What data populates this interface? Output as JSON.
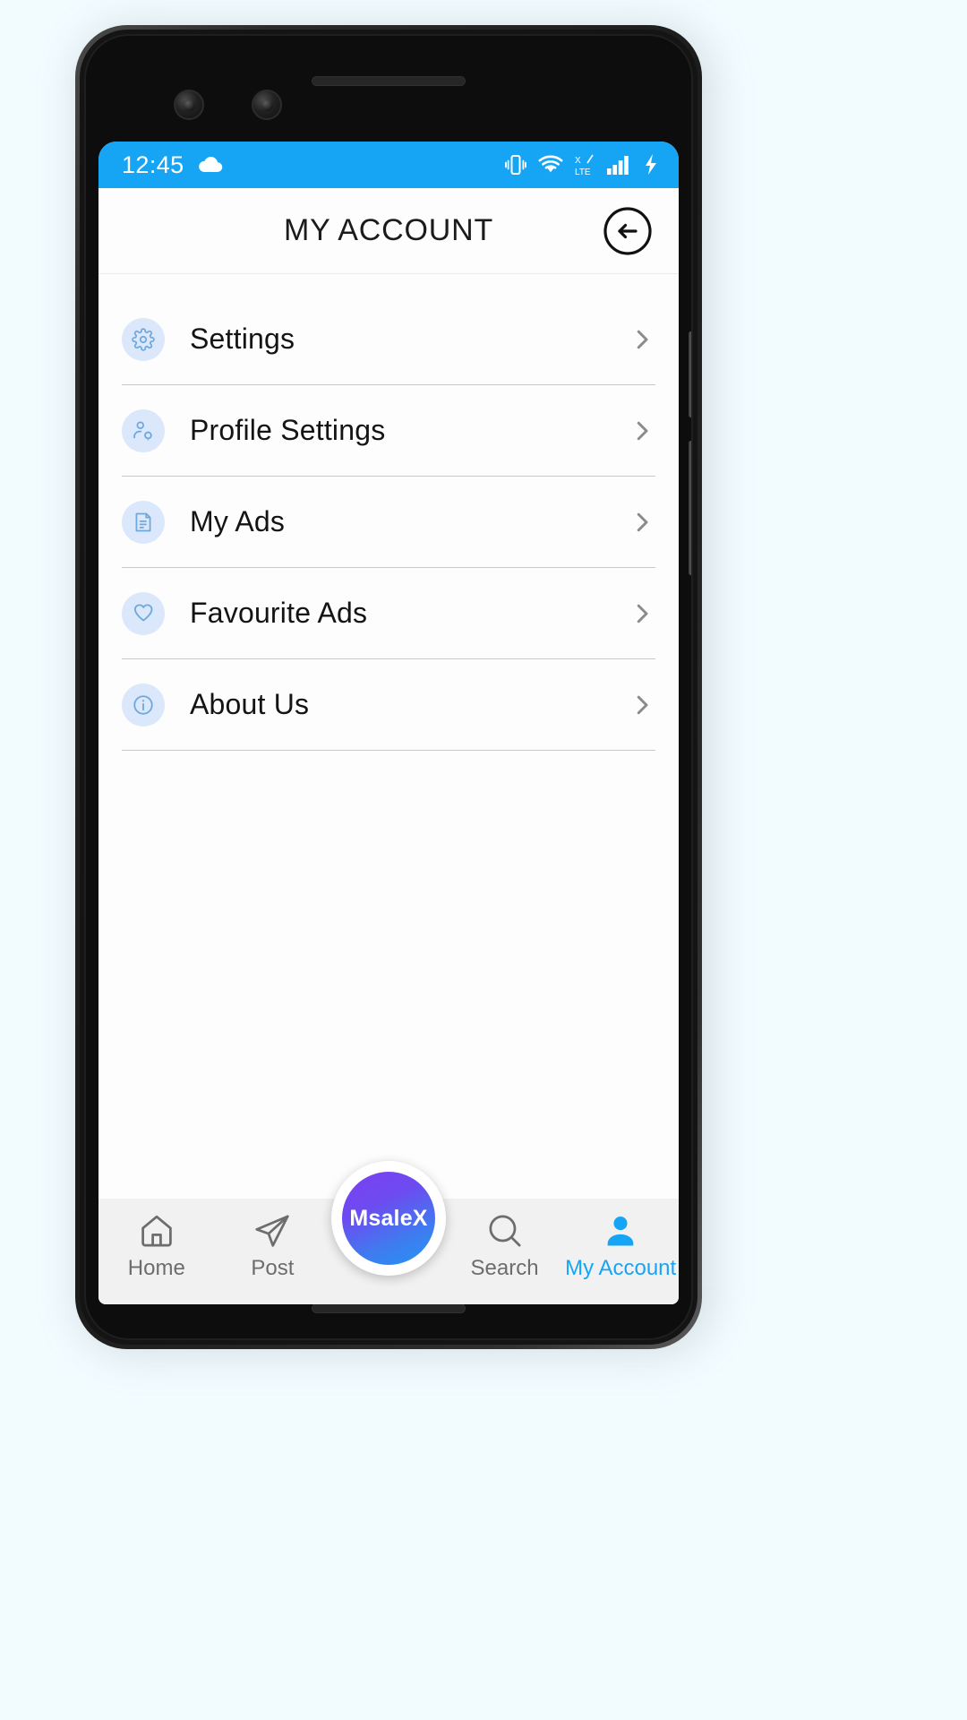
{
  "statusbar": {
    "time": "12:45",
    "icons": [
      {
        "name": "cloud-icon",
        "position": "left"
      },
      {
        "name": "vibrate-icon",
        "position": "right"
      },
      {
        "name": "wifi-icon",
        "position": "right"
      },
      {
        "name": "lte-signal-icon",
        "position": "right"
      },
      {
        "name": "cellular-signal-icon",
        "position": "right"
      },
      {
        "name": "battery-charging-icon",
        "position": "right"
      }
    ],
    "background_color": "#16a5f5"
  },
  "header": {
    "title": "MY ACCOUNT",
    "back_icon": "back-arrow-circle-icon"
  },
  "menu": {
    "items": [
      {
        "label": "Settings",
        "icon": "gear-icon",
        "chevron": "chevron-right-icon"
      },
      {
        "label": "Profile Settings",
        "icon": "person-gear-icon",
        "chevron": "chevron-right-icon"
      },
      {
        "label": "My Ads",
        "icon": "document-ad-icon",
        "chevron": "chevron-right-icon"
      },
      {
        "label": "Favourite Ads",
        "icon": "heart-icon",
        "chevron": "chevron-right-icon"
      },
      {
        "label": "About Us",
        "icon": "info-circle-icon",
        "chevron": "chevron-right-icon"
      }
    ]
  },
  "bottom_nav": {
    "items": [
      {
        "label": "Home",
        "icon": "home-icon",
        "active": false
      },
      {
        "label": "Post",
        "icon": "send-paper-plane-icon",
        "active": false
      },
      {
        "label": "Search",
        "icon": "search-icon",
        "active": false
      },
      {
        "label": "My Account",
        "icon": "person-icon",
        "active": true
      }
    ],
    "fab": {
      "label": "MsaleX",
      "gradient_from": "#7b3ff2",
      "gradient_to": "#2196f3"
    },
    "active_color": "#16a5f5",
    "inactive_color": "#6d6d6d"
  }
}
